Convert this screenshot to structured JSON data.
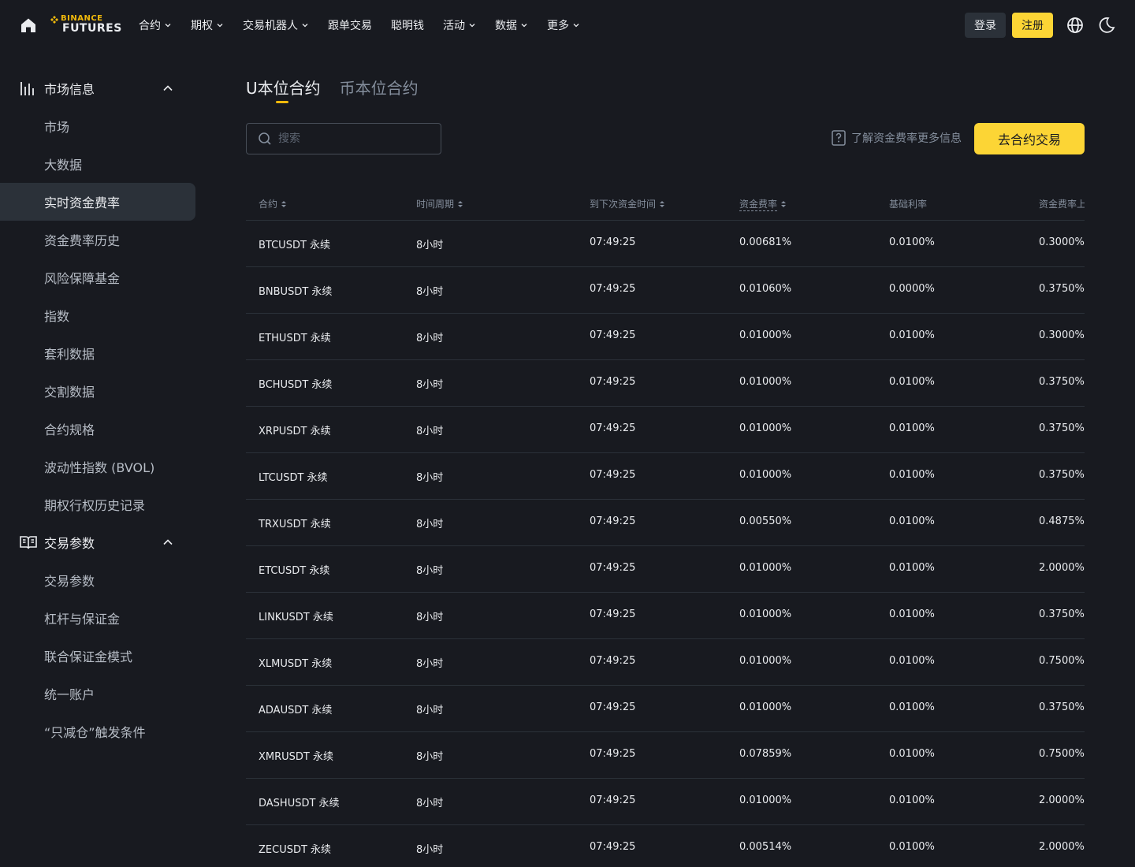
{
  "header": {
    "logo_top": "BINANCE",
    "logo_bottom": "FUTURES",
    "nav": [
      {
        "label": "合约",
        "dropdown": true
      },
      {
        "label": "期权",
        "dropdown": true
      },
      {
        "label": "交易机器人",
        "dropdown": true
      },
      {
        "label": "跟单交易",
        "dropdown": false
      },
      {
        "label": "聪明钱",
        "dropdown": false
      },
      {
        "label": "活动",
        "dropdown": true
      },
      {
        "label": "数据",
        "dropdown": true
      },
      {
        "label": "更多",
        "dropdown": true
      }
    ],
    "login_label": "登录",
    "register_label": "注册"
  },
  "sidebar": {
    "group1": {
      "label": "市场信息",
      "icon": "bar-chart-icon"
    },
    "group1_items": [
      "市场",
      "大数据",
      "实时资金费率",
      "资金费率历史",
      "风险保障基金",
      "指数",
      "套利数据",
      "交割数据",
      "合约规格",
      "波动性指数 (BVOL)",
      "期权行权历史记录"
    ],
    "active_item": "实时资金费率",
    "group2": {
      "label": "交易参数",
      "icon": "book-icon"
    },
    "group2_items": [
      "交易参数",
      "杠杆与保证金",
      "联合保证金模式",
      "统一账户",
      "“只减仓”触发条件"
    ]
  },
  "main": {
    "tabs": [
      {
        "label": "U本位合约",
        "active": true
      },
      {
        "label": "币本位合约",
        "active": false
      }
    ],
    "search_placeholder": "搜索",
    "learn_more": "了解资金费率更多信息",
    "trade_button": "去合约交易"
  },
  "table": {
    "columns": [
      "合约",
      "时间周期",
      "到下次资金时间",
      "资金费率",
      "基础利率",
      "资金费率上"
    ],
    "rows": [
      [
        "BTCUSDT 永续",
        "8小时",
        "07:49:25",
        "0.00681%",
        "0.0100%",
        "0.3000%"
      ],
      [
        "BNBUSDT 永续",
        "8小时",
        "07:49:25",
        "0.01060%",
        "0.0000%",
        "0.3750%"
      ],
      [
        "ETHUSDT 永续",
        "8小时",
        "07:49:25",
        "0.01000%",
        "0.0100%",
        "0.3000%"
      ],
      [
        "BCHUSDT 永续",
        "8小时",
        "07:49:25",
        "0.01000%",
        "0.0100%",
        "0.3750%"
      ],
      [
        "XRPUSDT 永续",
        "8小时",
        "07:49:25",
        "0.01000%",
        "0.0100%",
        "0.3750%"
      ],
      [
        "LTCUSDT 永续",
        "8小时",
        "07:49:25",
        "0.01000%",
        "0.0100%",
        "0.3750%"
      ],
      [
        "TRXUSDT 永续",
        "8小时",
        "07:49:25",
        "0.00550%",
        "0.0100%",
        "0.4875%"
      ],
      [
        "ETCUSDT 永续",
        "8小时",
        "07:49:25",
        "0.01000%",
        "0.0100%",
        "2.0000%"
      ],
      [
        "LINKUSDT 永续",
        "8小时",
        "07:49:25",
        "0.01000%",
        "0.0100%",
        "0.3750%"
      ],
      [
        "XLMUSDT 永续",
        "8小时",
        "07:49:25",
        "0.01000%",
        "0.0100%",
        "0.7500%"
      ],
      [
        "ADAUSDT 永续",
        "8小时",
        "07:49:25",
        "0.01000%",
        "0.0100%",
        "0.3750%"
      ],
      [
        "XMRUSDT 永续",
        "8小时",
        "07:49:25",
        "0.07859%",
        "0.0100%",
        "0.7500%"
      ],
      [
        "DASHUSDT 永续",
        "8小时",
        "07:49:25",
        "0.01000%",
        "0.0100%",
        "2.0000%"
      ],
      [
        "ZECUSDT 永续",
        "8小时",
        "07:49:25",
        "0.00514%",
        "0.0100%",
        "2.0000%"
      ]
    ]
  },
  "colors": {
    "background": "#181a20",
    "accent": "#fcd535",
    "muted": "#848e9c",
    "divider": "#2b3139"
  }
}
